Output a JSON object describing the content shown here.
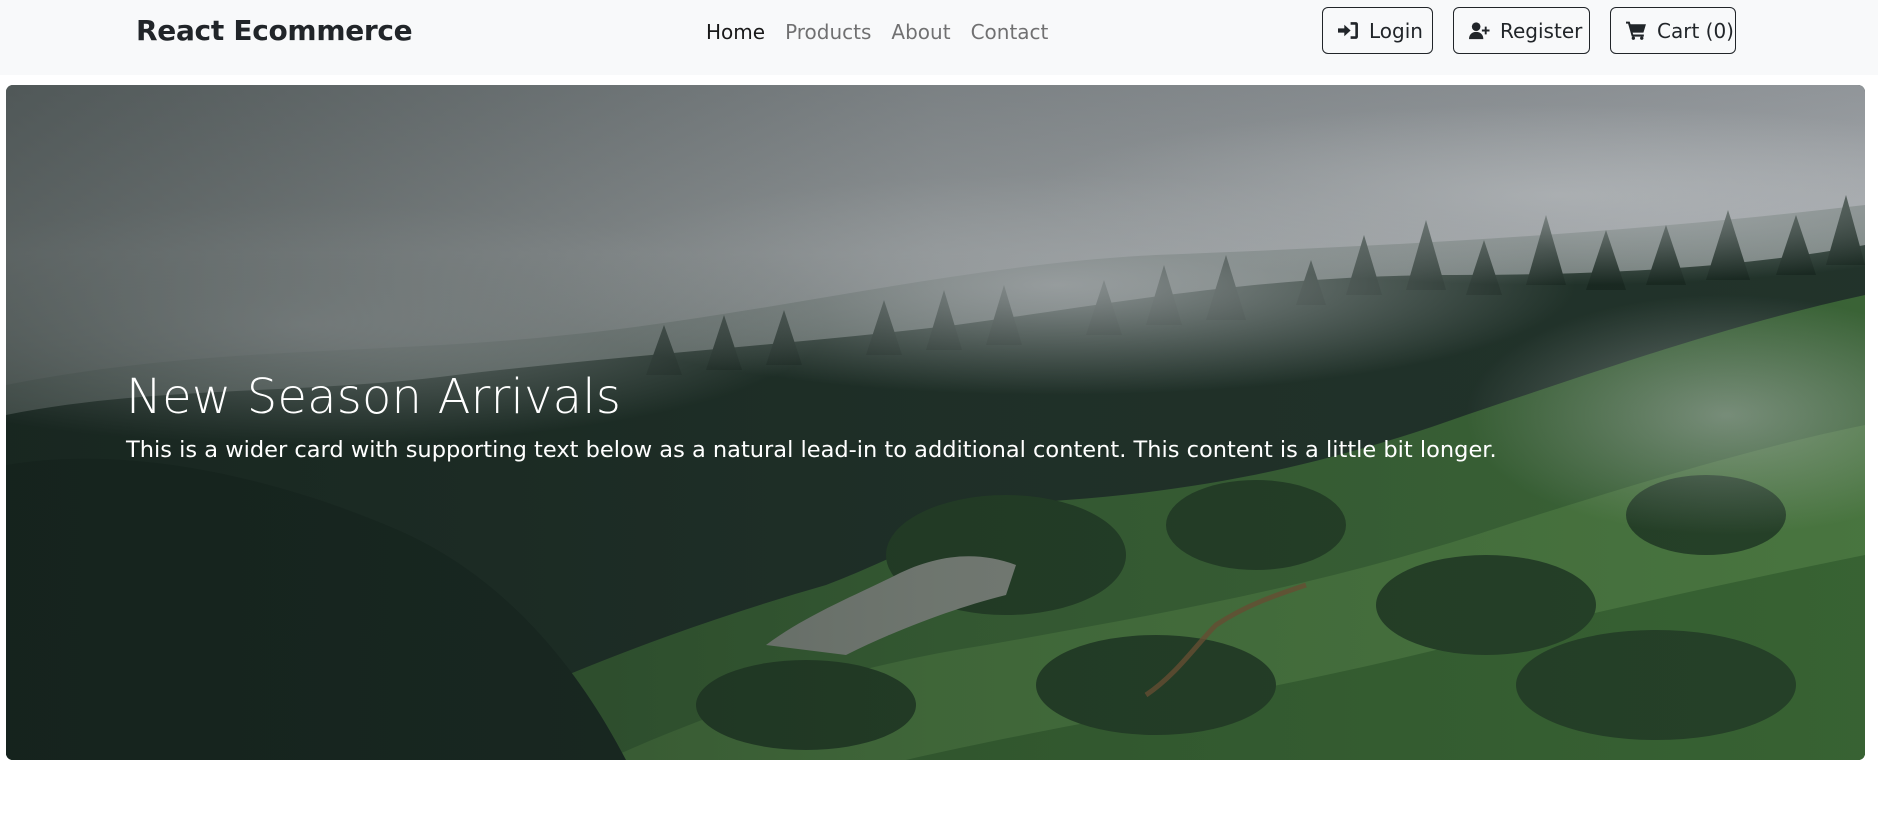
{
  "navbar": {
    "brand": "React Ecommerce",
    "links": [
      {
        "label": "Home",
        "active": true
      },
      {
        "label": "Products",
        "active": false
      },
      {
        "label": "About",
        "active": false
      },
      {
        "label": "Contact",
        "active": false
      }
    ],
    "buttons": {
      "login": {
        "label": "Login",
        "icon": "sign-in-icon"
      },
      "register": {
        "label": "Register",
        "icon": "user-plus-icon"
      },
      "cart": {
        "label": "Cart (0)",
        "icon": "shopping-cart-icon"
      }
    }
  },
  "hero": {
    "title": "New Season Arrivals",
    "subtitle": "This is a wider card with supporting text below as a natural lead-in to additional content. This content is a little bit longer.",
    "image": "misty-forest-hillside-photo"
  },
  "colors": {
    "navbar_bg": "#f8f9fa",
    "text_dark": "#212529",
    "hero_text": "#ffffff"
  }
}
